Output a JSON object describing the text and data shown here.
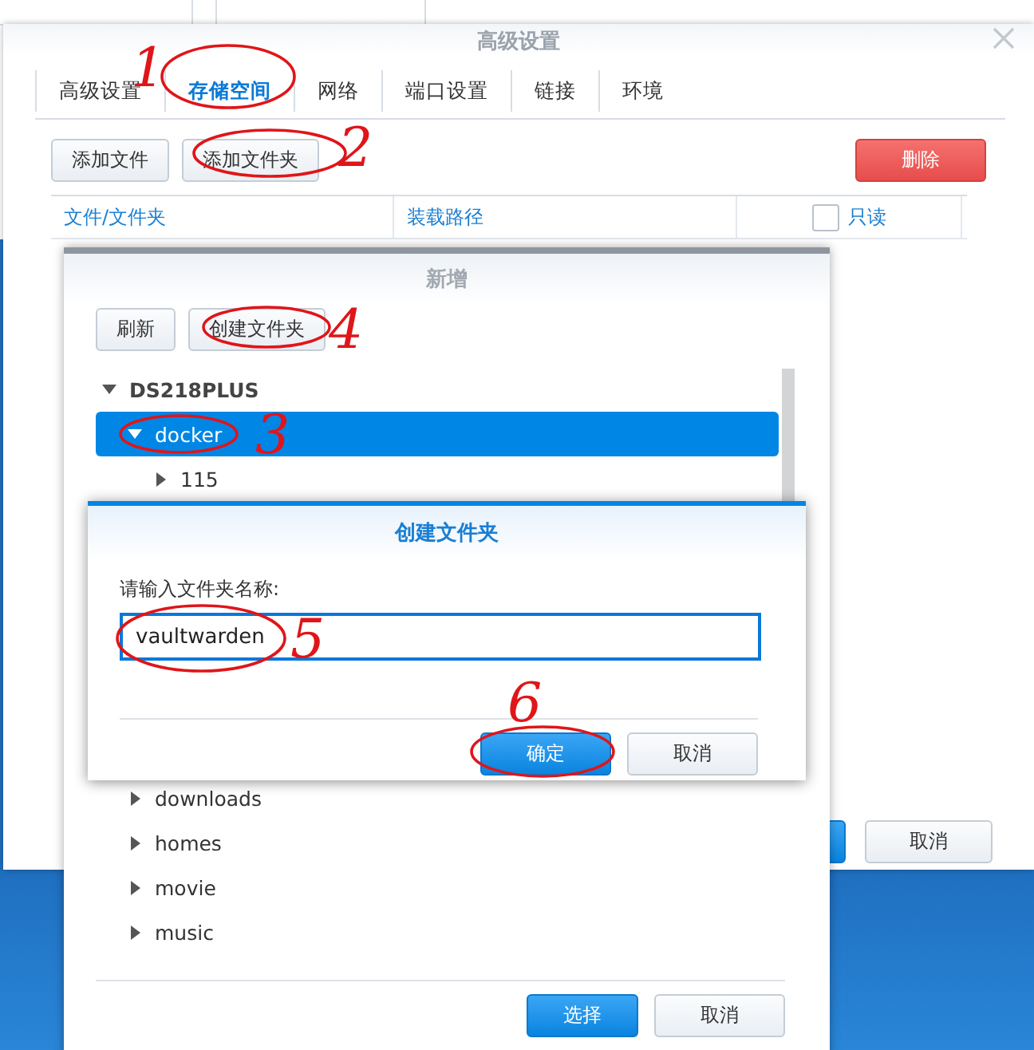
{
  "window": {
    "title": "高级设置"
  },
  "tabs": [
    {
      "label": "高级设置",
      "selected": false
    },
    {
      "label": "存储空间",
      "selected": true
    },
    {
      "label": "网络",
      "selected": false
    },
    {
      "label": "端口设置",
      "selected": false
    },
    {
      "label": "链接",
      "selected": false
    },
    {
      "label": "环境",
      "selected": false
    }
  ],
  "toolbar": [
    {
      "label": "添加文件",
      "kind": "default"
    },
    {
      "label": "添加文件夹",
      "kind": "default"
    },
    {
      "label": "删除",
      "kind": "danger"
    }
  ],
  "table": {
    "columns": [
      "文件/文件夹",
      "装载路径"
    ],
    "readonly": {
      "label": "只读",
      "checked": false
    }
  },
  "footer_buttons": [
    {
      "kind": "primary"
    },
    {
      "label": "取消",
      "kind": "default"
    }
  ],
  "add_dialog": {
    "title": "新增",
    "buttons": [
      {
        "label": "刷新"
      },
      {
        "label": "创建文件夹"
      }
    ],
    "tree": [
      {
        "label": "DS218PLUS",
        "expanded": true,
        "selected": false,
        "children": [
          {
            "label": "docker",
            "expanded": true,
            "selected": true,
            "children": [
              {
                "label": "115",
                "expanded": false,
                "selected": false
              }
            ]
          },
          {
            "label": "downloads",
            "expanded": false,
            "selected": false
          },
          {
            "label": "homes",
            "expanded": false,
            "selected": false
          },
          {
            "label": "movie",
            "expanded": false,
            "selected": false
          },
          {
            "label": "music",
            "expanded": false,
            "selected": false
          }
        ]
      }
    ],
    "footer_buttons": [
      {
        "label": "选择",
        "kind": "primary"
      },
      {
        "label": "取消",
        "kind": "default"
      }
    ]
  },
  "create_dialog": {
    "title": "创建文件夹",
    "prompt": "请输入文件夹名称:",
    "value": "vaultwarden",
    "buttons": [
      {
        "label": "确定",
        "kind": "primary"
      },
      {
        "label": "取消",
        "kind": "default"
      }
    ]
  },
  "annotations": [
    {
      "label": "1"
    },
    {
      "label": "2"
    },
    {
      "label": "3"
    },
    {
      "label": "4"
    },
    {
      "label": "5"
    },
    {
      "label": "6"
    }
  ]
}
